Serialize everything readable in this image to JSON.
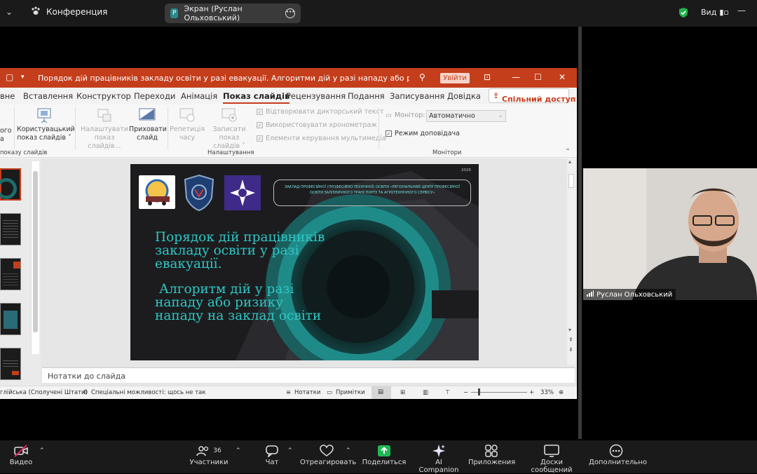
{
  "topbar": {
    "conference_label": "Конференция",
    "screen_label": "Экран (Руслан Ольховський)",
    "view_label": "Вид"
  },
  "ppt": {
    "title": "Порядок дій працівників закладу освіти у разі евакуації. Алгоритми дій у разі нападу або ризику нападу на заклад осві...",
    "signin": "Увійти",
    "tabs": [
      "вне",
      "Вставлення",
      "Конструктор",
      "Переходи",
      "Анімація",
      "Показ слайдів",
      "Рецензування",
      "Подання",
      "Записування",
      "Довідка"
    ],
    "share": "Спільний доступ",
    "ribbon": {
      "from_prefix": "ого",
      "from_prefix2": "а",
      "custom_show": "Користувацький",
      "custom_show2": "показ слайдів ˅",
      "setup": "Налаштувати",
      "setup2": "показ слайдів...",
      "hide": "Приховати",
      "hide2": "слайд",
      "rehearse": "Репетиція",
      "rehearse2": "часу",
      "record": "Записати показ",
      "record2": "слайдів ˅",
      "play_narr": "Відтворювати дикторський текст",
      "use_timings": "Використовувати хронометраж",
      "media": "Елементи керування мультимедіа",
      "monitor_label": "Монітор:",
      "monitor_value": "Автоматично",
      "presenter": "Режим доповідача",
      "grp_start": "показу слайдів",
      "grp_setup": "Налаштування",
      "grp_monitors": "Монітори"
    },
    "slide": {
      "year": "2026",
      "org": "ЗАКЛАД ПРОФЕСІЙНОЇ (ПРОФЕСІЙНО-ТЕХНІЧНОЇ) ОСВІТИ «РЕГІОНАЛЬНИЙ ЦЕНТР ПРОФЕСІЙНОЇ ОСВІТИ ЗАЛІЗНИЧНОГО ТРАНСПОРТУ ТА АГРОТЕХНІЧНОГО СЕРВІСУ»",
      "line1": "Порядок дій працівників",
      "line2": "закладу освіти у разі",
      "line3": "евакуації.",
      "line4": "Алгоритм дій у разі",
      "line5": "нападу або ризику",
      "line6": "нападу на заклад освіти"
    },
    "notes": "Нотатки до слайда",
    "status": {
      "lang": "глійська (Сполучені Штати)",
      "access": "Спеціальні можливості: щось не так",
      "notes": "Нотатки",
      "comments": "Примітки",
      "zoom": "33%"
    }
  },
  "participant": {
    "name": "Руслан Ольховський"
  },
  "toolbar": {
    "video": "Видео",
    "participants": "Участники",
    "participants_count": "36",
    "chat": "Чат",
    "react": "Отреагировать",
    "share": "Поделиться",
    "ai": "AI Companion",
    "apps": "Приложения",
    "whiteboards": "Доски сообщений",
    "more": "Дополнительно"
  },
  "colors": {
    "ppt_accent": "#c43e1c",
    "slide_text": "#2fc7c4",
    "share_green": "#1db954"
  }
}
